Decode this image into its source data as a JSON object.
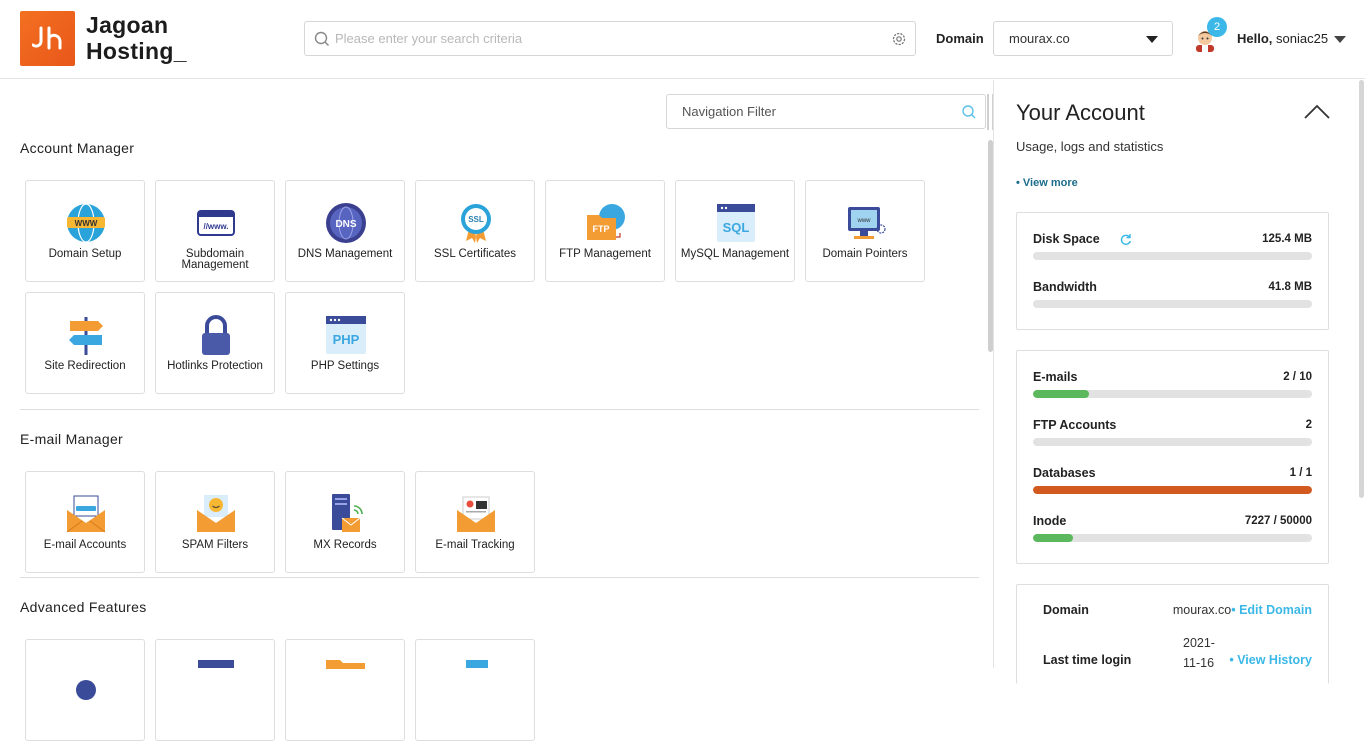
{
  "header": {
    "logo_line1": "Jagoan",
    "logo_line2": "Hosting_",
    "search_placeholder": "Please enter your search criteria",
    "domain_label": "Domain",
    "domain_value": "mourax.co",
    "notification_count": "2",
    "hello_label": "Hello,",
    "username": "soniac25"
  },
  "nav_filter": {
    "placeholder": "Navigation Filter"
  },
  "sections": {
    "account_manager": {
      "title": "Account Manager",
      "tiles": [
        {
          "label": "Domain Setup",
          "icon": "globe-www-icon"
        },
        {
          "label": "Subdomain Management",
          "icon": "subdomain-icon"
        },
        {
          "label": "DNS Management",
          "icon": "dns-icon"
        },
        {
          "label": "SSL Certificates",
          "icon": "ssl-badge-icon"
        },
        {
          "label": "FTP Management",
          "icon": "ftp-folder-icon"
        },
        {
          "label": "MySQL Management",
          "icon": "sql-icon"
        },
        {
          "label": "Domain Pointers",
          "icon": "monitor-www-icon"
        },
        {
          "label": "Site Redirection",
          "icon": "signpost-icon"
        },
        {
          "label": "Hotlinks Protection",
          "icon": "padlock-icon"
        },
        {
          "label": "PHP Settings",
          "icon": "php-icon"
        }
      ]
    },
    "email_manager": {
      "title": "E-mail Manager",
      "tiles": [
        {
          "label": "E-mail Accounts",
          "icon": "envelope-icon"
        },
        {
          "label": "SPAM Filters",
          "icon": "spam-envelope-icon"
        },
        {
          "label": "MX Records",
          "icon": "mx-server-icon"
        },
        {
          "label": "E-mail Tracking",
          "icon": "email-tracking-icon"
        }
      ]
    },
    "advanced_features": {
      "title": "Advanced Features"
    }
  },
  "account": {
    "title": "Your Account",
    "subtitle": "Usage, logs and statistics",
    "view_more": "• View more",
    "usage": [
      {
        "name": "Disk Space",
        "value": "125.4 MB",
        "fraction": 0,
        "color": "#4caf50"
      },
      {
        "name": "Bandwidth",
        "value": "41.8 MB",
        "fraction": 0,
        "color": "#4caf50"
      }
    ],
    "limits": [
      {
        "name": "E-mails",
        "value": "2 / 10",
        "fraction": 0.2,
        "color": "#5cb85c"
      },
      {
        "name": "FTP Accounts",
        "value": "2",
        "fraction": 0,
        "color": "#5cb85c"
      },
      {
        "name": "Databases",
        "value": "1 / 1",
        "fraction": 1.0,
        "color": "#d35a1f"
      },
      {
        "name": "Inode",
        "value": "7227 / 50000",
        "fraction": 0.145,
        "color": "#5cb85c"
      }
    ],
    "domain_label": "Domain",
    "domain_value": "mourax.co",
    "edit_domain": "• Edit Domain",
    "last_login_label": "Last time login",
    "last_login_value_1": "2021-",
    "last_login_value_2": "11-16",
    "view_history": "• View History"
  },
  "colors": {
    "accent": "#3bb8e8",
    "brand": "#f37021"
  }
}
